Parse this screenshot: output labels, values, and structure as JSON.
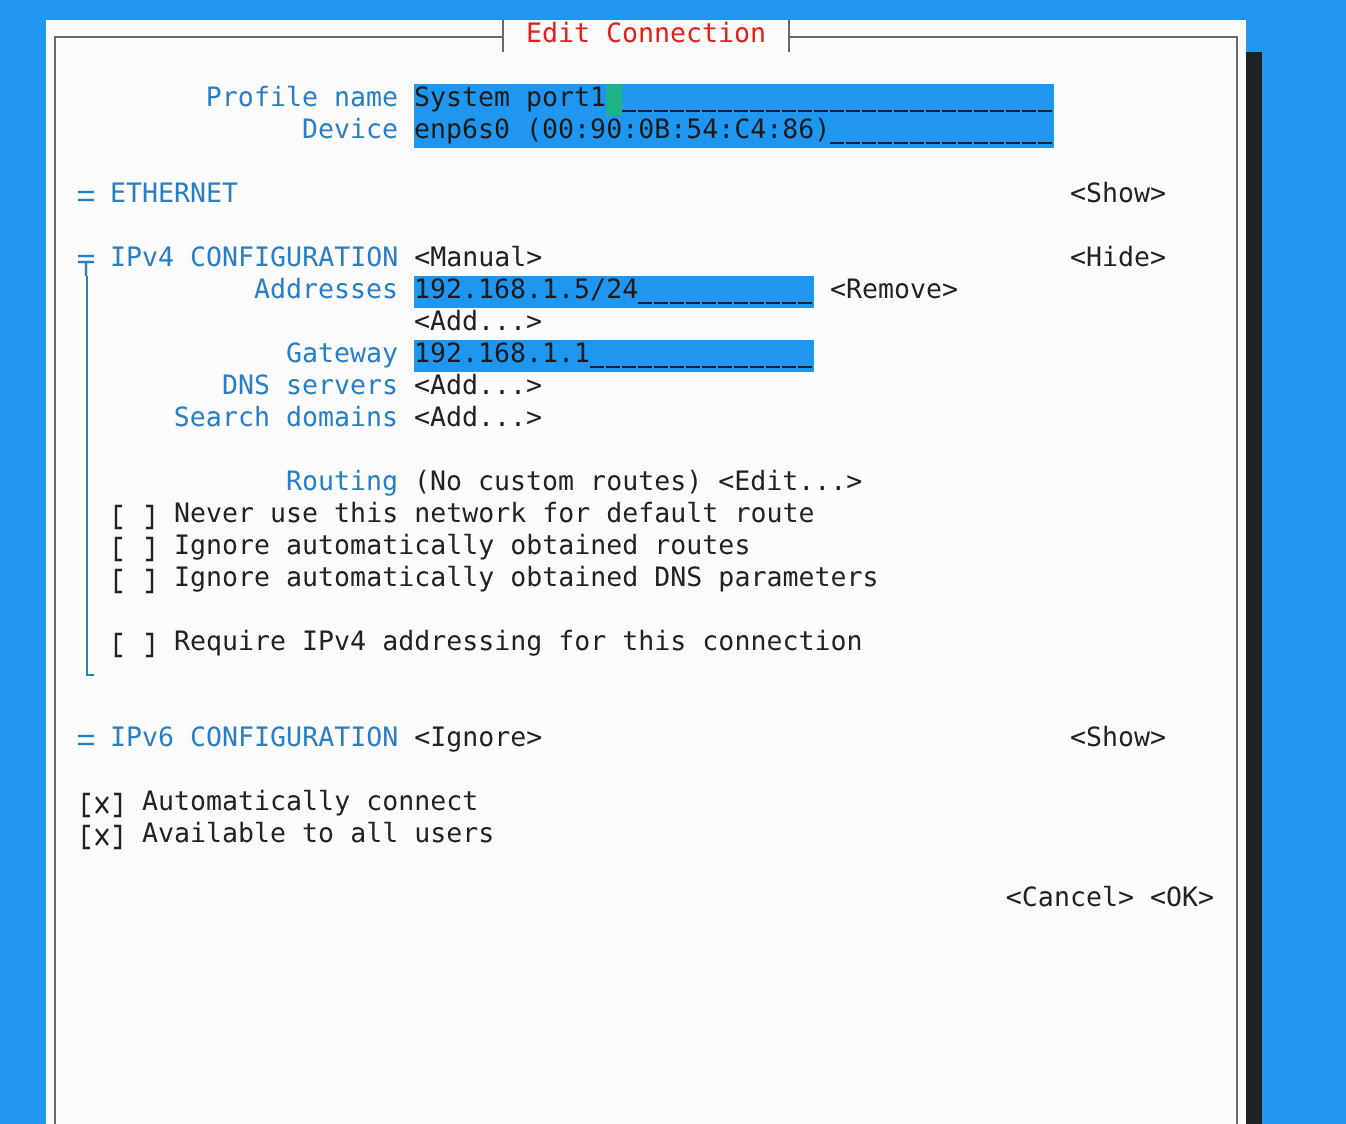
{
  "dialog": {
    "title": "Edit Connection"
  },
  "fields": [
    {
      "label": "Profile name",
      "value": "System port1",
      "focused": true
    },
    {
      "label": "Device",
      "value": "enp6s0 (00:90:0B:54:C4:86)",
      "focused": false
    }
  ],
  "sections": [
    {
      "title": "ETHERNET",
      "toggle": "<Show>",
      "expanded": false
    },
    {
      "title": "IPv4 CONFIGURATION",
      "mode": "<Manual>",
      "toggle": "<Hide>",
      "expanded": true,
      "rows": [
        {
          "kind": "field",
          "label": "Addresses",
          "value": "192.168.1.5/24",
          "focused": false,
          "button": "<Remove>"
        },
        {
          "kind": "button",
          "button": "<Add...>"
        },
        {
          "kind": "field",
          "label": "Gateway",
          "value": "192.168.1.1",
          "focused": false
        },
        {
          "kind": "button",
          "label": "DNS servers",
          "button": "<Add...>"
        },
        {
          "kind": "button",
          "label": "Search domains",
          "button": "<Add...>"
        },
        {
          "kind": "blank"
        },
        {
          "kind": "text",
          "label": "Routing",
          "text": "(No custom routes)",
          "button": "<Edit...>"
        },
        {
          "kind": "checkbox",
          "label": "Never use this network for default route",
          "checked": false
        },
        {
          "kind": "checkbox",
          "label": "Ignore automatically obtained routes",
          "checked": false
        },
        {
          "kind": "checkbox",
          "label": "Ignore automatically obtained DNS parameters",
          "checked": false
        },
        {
          "kind": "blank"
        },
        {
          "kind": "checkbox",
          "label": "Require IPv4 addressing for this connection",
          "checked": false
        }
      ]
    },
    {
      "title": "IPv6 CONFIGURATION",
      "mode": "<Ignore>",
      "toggle": "<Show>",
      "expanded": false
    }
  ],
  "options": [
    {
      "label": "Automatically connect",
      "checked": true
    },
    {
      "label": "Available to all users",
      "checked": true
    }
  ],
  "buttons": [
    "<Cancel>",
    "<OK>"
  ]
}
